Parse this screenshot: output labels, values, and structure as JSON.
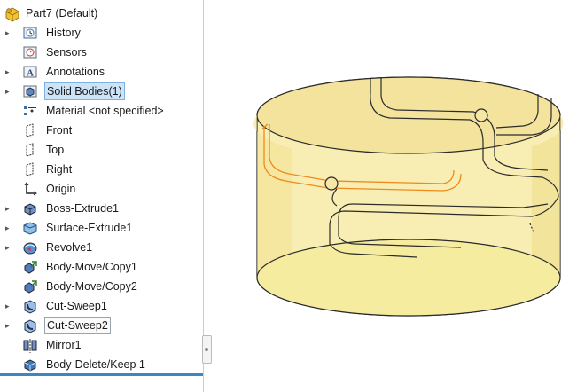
{
  "tree": {
    "root": {
      "label": "Part7  (Default)",
      "icon": "part-icon"
    },
    "items": [
      {
        "label": "History",
        "icon": "history-icon",
        "expandable": true
      },
      {
        "label": "Sensors",
        "icon": "sensors-icon",
        "expandable": false
      },
      {
        "label": "Annotations",
        "icon": "annotations-icon",
        "expandable": true
      },
      {
        "label": "Solid Bodies(1)",
        "icon": "solid-bodies-icon",
        "expandable": true,
        "selected": true
      },
      {
        "label": "Material <not specified>",
        "icon": "material-icon",
        "expandable": false
      },
      {
        "label": "Front",
        "icon": "plane-icon",
        "expandable": false
      },
      {
        "label": "Top",
        "icon": "plane-icon",
        "expandable": false
      },
      {
        "label": "Right",
        "icon": "plane-icon",
        "expandable": false
      },
      {
        "label": "Origin",
        "icon": "origin-icon",
        "expandable": false
      },
      {
        "label": "Boss-Extrude1",
        "icon": "boss-extrude-icon",
        "expandable": true
      },
      {
        "label": "Surface-Extrude1",
        "icon": "surface-extrude-icon",
        "expandable": true
      },
      {
        "label": "Revolve1",
        "icon": "revolve-icon",
        "expandable": true
      },
      {
        "label": "Body-Move/Copy1",
        "icon": "body-move-icon",
        "expandable": false
      },
      {
        "label": "Body-Move/Copy2",
        "icon": "body-move-icon",
        "expandable": false
      },
      {
        "label": "Cut-Sweep1",
        "icon": "cut-sweep-icon",
        "expandable": true
      },
      {
        "label": "Cut-Sweep2",
        "icon": "cut-sweep-icon",
        "expandable": true,
        "boxed": true
      },
      {
        "label": "Mirror1",
        "icon": "mirror-icon",
        "expandable": false
      },
      {
        "label": "Body-Delete/Keep 1",
        "icon": "body-delete-icon",
        "expandable": false
      }
    ]
  },
  "colors": {
    "body_fill": "#f7ecae",
    "body_edge": "#2b2b2b",
    "highlight_edge": "#f08a1c",
    "selection_bg": "#cde3f7",
    "accent_bar": "#3a87c8"
  },
  "viewport": {
    "model": "cylindrical part with swept cut grooves"
  }
}
